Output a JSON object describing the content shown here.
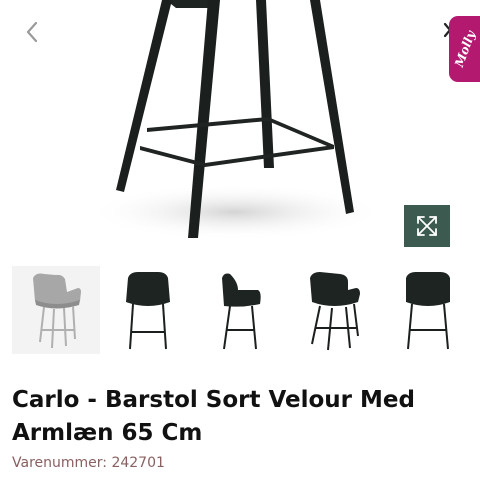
{
  "product": {
    "title": "Carlo - Barstol Sort Velour Med Armlæn 65 Cm",
    "sku_label": "Varenummer:",
    "sku_value": "242701"
  },
  "badge": {
    "text": "Molly"
  },
  "colors": {
    "badge": "#b3196e",
    "expand_button": "#3c5a50",
    "sku_text": "#8a6060",
    "thumb_selected_bg": "#f3f3f3",
    "stool_dark": "#1d2421",
    "stool_grey": "#a7a7a7"
  },
  "icons": {
    "back": "chevron-left-icon",
    "close": "close-icon",
    "expand": "expand-arrows-icon"
  },
  "gallery": {
    "selected_index": 0,
    "thumbnails": [
      {
        "color": "grey",
        "view": "three-quarter"
      },
      {
        "color": "black",
        "view": "front"
      },
      {
        "color": "black",
        "view": "side"
      },
      {
        "color": "black",
        "view": "three-quarter"
      },
      {
        "color": "black",
        "view": "back"
      }
    ]
  }
}
